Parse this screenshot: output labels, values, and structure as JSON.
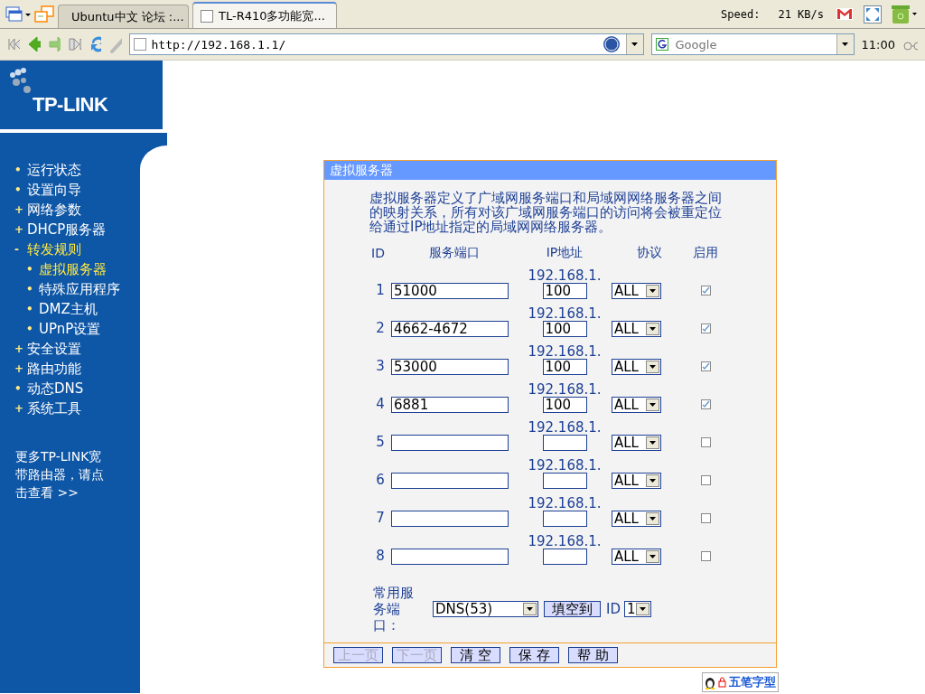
{
  "browser": {
    "tabs": [
      {
        "title": "Ubuntu中文 论坛 :...",
        "selected": false
      },
      {
        "title": "TL-R410多功能宽...",
        "selected": true
      }
    ],
    "speed_label": "Speed:",
    "speed_value": "21 KB/s",
    "url": "http://192.168.1.1/",
    "search_placeholder": "Google",
    "clock": "11:00"
  },
  "sidebar": {
    "logo": "TP-LINK",
    "items": [
      {
        "marker": "•",
        "label": "运行状态",
        "highlighted": false
      },
      {
        "marker": "•",
        "label": "设置向导",
        "highlighted": false
      },
      {
        "marker": "+",
        "label": "网络参数",
        "highlighted": false
      },
      {
        "marker": "+",
        "label": "DHCP服务器",
        "highlighted": false
      },
      {
        "marker": "-",
        "label": "转发规则",
        "highlighted": true,
        "children": [
          {
            "marker": "•",
            "label": "虚拟服务器",
            "highlighted": true
          },
          {
            "marker": "•",
            "label": "特殊应用程序",
            "highlighted": false
          },
          {
            "marker": "•",
            "label": "DMZ主机",
            "highlighted": false
          },
          {
            "marker": "•",
            "label": "UPnP设置",
            "highlighted": false
          }
        ]
      },
      {
        "marker": "+",
        "label": "安全设置",
        "highlighted": false
      },
      {
        "marker": "+",
        "label": "路由功能",
        "highlighted": false
      },
      {
        "marker": "•",
        "label": "动态DNS",
        "highlighted": false
      },
      {
        "marker": "+",
        "label": "系统工具",
        "highlighted": false
      }
    ],
    "more_link": "更多TP-LINK宽带路由器，请点击查看 >>"
  },
  "panel": {
    "title": "虚拟服务器",
    "description": "虚拟服务器定义了广域网服务端口和局域网网络服务器之间的映射关系，所有对该广域网服务端口的访问将会被重定位给通过IP地址指定的局域网网络服务器。",
    "columns": [
      "ID",
      "服务端口",
      "IP地址",
      "协议",
      "启用"
    ],
    "rows": [
      {
        "id": "1",
        "port": "51000",
        "ip_prefix": "192.168.1.",
        "ip_suffix": "100",
        "protocol": "ALL",
        "enabled": true
      },
      {
        "id": "2",
        "port": "4662-4672",
        "ip_prefix": "192.168.1.",
        "ip_suffix": "100",
        "protocol": "ALL",
        "enabled": true
      },
      {
        "id": "3",
        "port": "53000",
        "ip_prefix": "192.168.1.",
        "ip_suffix": "100",
        "protocol": "ALL",
        "enabled": true
      },
      {
        "id": "4",
        "port": "6881",
        "ip_prefix": "192.168.1.",
        "ip_suffix": "100",
        "protocol": "ALL",
        "enabled": true
      },
      {
        "id": "5",
        "ip_prefix": "192.168.1.",
        "protocol": "ALL",
        "enabled": false
      },
      {
        "id": "6",
        "ip_prefix": "192.168.1.",
        "protocol": "ALL",
        "enabled": false
      },
      {
        "id": "7",
        "ip_prefix": "192.168.1.",
        "protocol": "ALL",
        "enabled": false
      },
      {
        "id": "8",
        "ip_prefix": "192.168.1.",
        "protocol": "ALL",
        "enabled": false
      }
    ],
    "common_label": "常用服务端口：",
    "common_value": "DNS(53)",
    "fill_button": "填空到",
    "id_label": "ID",
    "id_value": "1",
    "buttons": [
      {
        "label": "上一页",
        "disabled": true
      },
      {
        "label": "下一页",
        "disabled": true
      },
      {
        "label": "清 空",
        "disabled": false
      },
      {
        "label": "保 存",
        "disabled": false
      },
      {
        "label": "帮 助",
        "disabled": false
      }
    ]
  },
  "ime_status": "五笔字型"
}
